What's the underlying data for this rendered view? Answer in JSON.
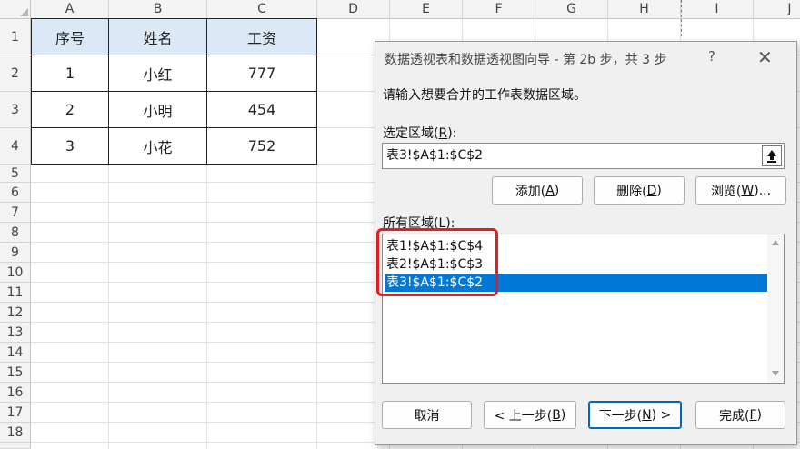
{
  "sheet": {
    "columns": [
      "A",
      "B",
      "C",
      "D",
      "E",
      "F",
      "G",
      "H",
      "I",
      "J"
    ],
    "rows": [
      "1",
      "2",
      "3",
      "4",
      "5",
      "6",
      "7",
      "8",
      "9",
      "10",
      "11",
      "12",
      "13",
      "14",
      "15",
      "16",
      "17",
      "18",
      "19",
      "20",
      "21",
      "22"
    ],
    "table": {
      "headers": [
        "序号",
        "姓名",
        "工资"
      ],
      "rows": [
        [
          "1",
          "小红",
          "777"
        ],
        [
          "2",
          "小明",
          "454"
        ],
        [
          "3",
          "小花",
          "752"
        ]
      ]
    }
  },
  "dialog": {
    "title": "数据透视表和数据透视图向导 - 第 2b 步，共 3 步",
    "help": "?",
    "close": "✕",
    "instruction": "请输入想要合并的工作表数据区域。",
    "range_label": "选定区域(",
    "range_label_key": "R",
    "range_label_end": "):",
    "range_value": "表3!$A$1:$C$2",
    "add_label": "添加(",
    "add_key": "A",
    "delete_label": "删除(",
    "delete_key": "D",
    "browse_label": "浏览(",
    "browse_key": "W",
    "browse_end": ")...",
    "all_ranges_label": "所有区域(",
    "all_ranges_key": "L",
    "all_ranges": [
      "表1!$A$1:$C$4",
      "表2!$A$1:$C$3",
      "表3!$A$1:$C$2"
    ],
    "cancel_label": "取消",
    "back_label": "< 上一步(",
    "back_key": "B",
    "next_label": "下一步(",
    "next_key": "N",
    "next_end": ") >",
    "finish_label": "完成(",
    "finish_key": "F",
    "close_paren": ")",
    "colors": {
      "selection": "#0078d7",
      "highlight": "#e02020",
      "header_fill": "#dbe9f6"
    }
  }
}
